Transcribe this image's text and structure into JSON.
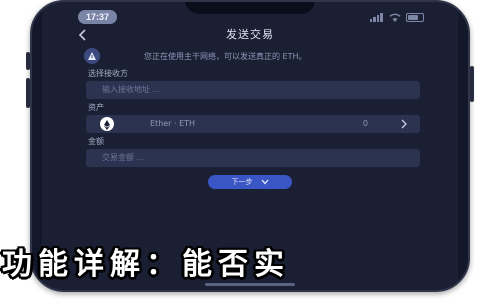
{
  "status_bar": {
    "time": "17:37"
  },
  "nav": {
    "title": "发送交易"
  },
  "notice": {
    "text": "您正在使用主干网络，可以发送真正的 ETH。"
  },
  "form": {
    "network_label": "选择接收方",
    "network_placeholder": "输入接收地址 ...",
    "asset_label": "资产",
    "asset_name": "Ether · ETH",
    "asset_balance": "0",
    "amount_label": "金额",
    "amount_placeholder": "交易金额 ..."
  },
  "actions": {
    "next_label": "下一步"
  },
  "caption": {
    "text": "功能详解：能否实"
  },
  "colors": {
    "screen_bg": "#1a1f33",
    "field_bg": "#2c3350",
    "accent": "#3a55c4"
  }
}
